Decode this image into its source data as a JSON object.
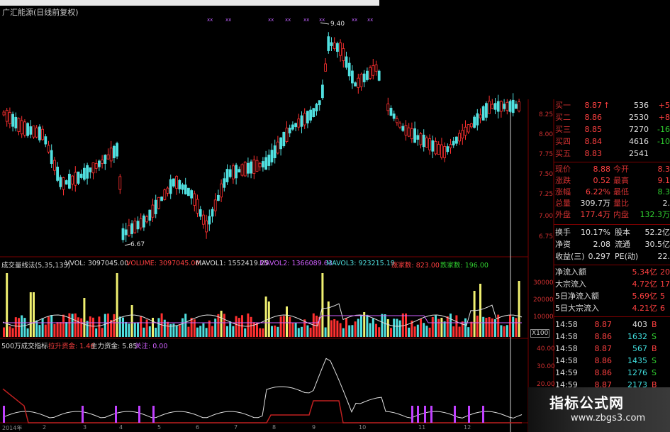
{
  "stock": {
    "title": "广汇能源(日线前复权)"
  },
  "candles": {
    "high_label": "9.40",
    "low_label": "6.67"
  },
  "price_axis": [
    "8.25",
    "8.00",
    "7.75",
    "7.50",
    "7.25",
    "7.00",
    "6.75"
  ],
  "volume_panel": {
    "name": "成交量线法(5,35,135)",
    "vvol": "VVOL: 3097045.00",
    "volume": "VOLUME: 3097045.00",
    "mavol1": "MAVOL1: 1552419.25",
    "mavol2": "MAVOL2: 1366089.63",
    "mavol3": "MAVOL3: 923215.19",
    "up_count": "涨家数: 823.00",
    "down_count": "跌家数: 196.00",
    "axis": [
      "30000",
      "20000",
      "10000",
      "X100"
    ]
  },
  "money_panel": {
    "name": "500万成交指标",
    "pull": "拉升资金: 1.46",
    "main": "主力资金: 5.85",
    "watch": "关注: 0.00",
    "axis": [
      "40.00",
      "30.00",
      "20.00"
    ]
  },
  "dates": [
    "2014年",
    "2",
    "3",
    "4",
    "5",
    "6",
    "7",
    "8",
    "9",
    "10",
    "11",
    "12"
  ],
  "bids": [
    {
      "label": "买一",
      "price": "8.87",
      "arrow": "↑",
      "volume": "536",
      "change": "+5"
    },
    {
      "label": "买二",
      "price": "8.86",
      "volume": "2530",
      "change": "+8"
    },
    {
      "label": "买三",
      "price": "8.85",
      "volume": "7270",
      "change": "-16"
    },
    {
      "label": "买四",
      "price": "8.84",
      "volume": "4616",
      "change": "-10"
    },
    {
      "label": "买五",
      "price": "8.83",
      "volume": "2541",
      "change": ""
    }
  ],
  "stats": [
    {
      "l1": "现价",
      "v1": "8.88",
      "l2": "今开",
      "v2": "8.3"
    },
    {
      "l1": "涨跌",
      "v1": "0.52",
      "l2": "最高",
      "v2": "9.1"
    },
    {
      "l1": "涨幅",
      "v1": "6.22%",
      "l2": "最低",
      "v2": "8.3"
    },
    {
      "l1": "总量",
      "v1": "309.7万",
      "l2": "量比",
      "v2": "2."
    },
    {
      "l1": "外盘",
      "v1": "177.4万",
      "l2": "内盘",
      "v2": "132.3万"
    }
  ],
  "stats2": [
    {
      "l1": "换手",
      "v1": "10.17%",
      "l2": "股本",
      "v2": "52.2亿"
    },
    {
      "l1": "净资",
      "v1": "2.08",
      "l2": "流通",
      "v2": "30.5亿"
    },
    {
      "l1": "收益(三)",
      "v1": "0.297",
      "l2": "PE(动)",
      "v2": "22."
    }
  ],
  "flows": [
    {
      "label": "净流入额",
      "value": "5.34亿",
      "pct": "20"
    },
    {
      "label": "大宗流入",
      "value": "4.72亿",
      "pct": "17"
    },
    {
      "label": "5日净流入额",
      "value": "5.69亿",
      "pct": "5"
    },
    {
      "label": "5日大宗流入",
      "value": "4.21亿",
      "pct": "6"
    }
  ],
  "ticks": [
    {
      "time": "14:58",
      "price": "8.87",
      "vol": "403",
      "side": "B"
    },
    {
      "time": "14:58",
      "price": "8.86",
      "vol": "1632",
      "side": "S"
    },
    {
      "time": "14:58",
      "price": "8.87",
      "vol": "567",
      "side": "B"
    },
    {
      "time": "14:58",
      "price": "8.86",
      "vol": "1435",
      "side": "S"
    },
    {
      "time": "14:59",
      "price": "8.86",
      "vol": "1276",
      "side": "S"
    },
    {
      "time": "14:59",
      "price": "8.87",
      "vol": "2173",
      "side": "B"
    }
  ],
  "logo": {
    "name": "指标公式网",
    "url": "www.zbgs3.com"
  },
  "colors": {
    "up": "#ff3030",
    "down": "#50e0e0",
    "bg": "#000000",
    "grid": "#7a0000"
  }
}
